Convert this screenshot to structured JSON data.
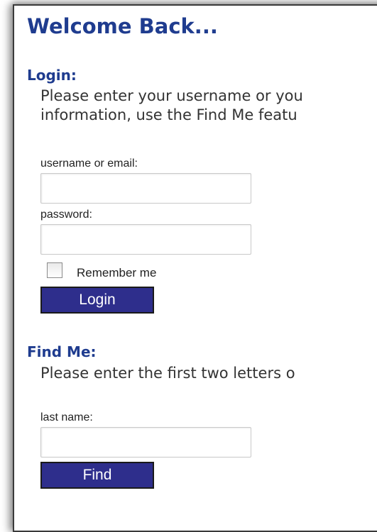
{
  "heading": "Welcome Back...",
  "login": {
    "title": "Login:",
    "instructions_line1": "Please enter your username or you",
    "instructions_line2": "information, use the Find Me featu",
    "username_label": "username or email:",
    "username_value": "",
    "password_label": "password:",
    "password_value": "",
    "remember_label": "Remember me",
    "remember_checked": false,
    "button_label": "Login"
  },
  "find_me": {
    "title": "Find Me:",
    "instructions": "Please enter the first two letters o",
    "last_name_label": "last name:",
    "last_name_value": "",
    "button_label": "Find"
  },
  "colors": {
    "heading": "#1f3c8f",
    "button_bg": "#2e2e8c",
    "button_text": "#ffffff"
  }
}
